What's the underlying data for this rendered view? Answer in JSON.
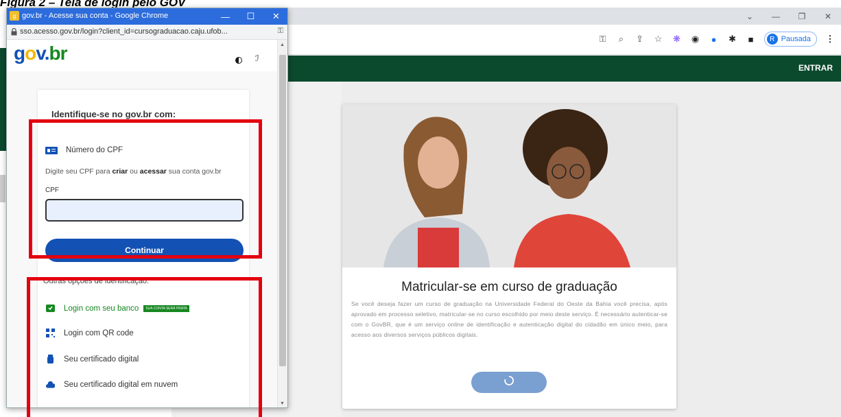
{
  "doc_caption": "Figura 2 – Tela de login pelo GOV",
  "popup": {
    "title": "gov.br - Acesse sua conta - Google Chrome",
    "url": "sso.acesso.gov.br/login?client_id=cursograduacao.caju.ufob...",
    "logo": {
      "g": "g",
      "o": "o",
      "v": "v",
      "dot": ".",
      "br": "br"
    },
    "login": {
      "title": "Identifique-se no gov.br com:",
      "cpf_option_label": "Número do CPF",
      "cpf_desc_pre": "Digite seu CPF para ",
      "cpf_desc_criar": "criar",
      "cpf_desc_mid": " ou ",
      "cpf_desc_acessar": "acessar",
      "cpf_desc_post": " sua conta gov.br",
      "cpf_field_label": "CPF",
      "cpf_value": "",
      "continue_label": "Continuar",
      "other_options_label": "Outras opções de identificação:",
      "options": [
        {
          "label": "Login com seu banco",
          "icon": "bank-icon",
          "badge": "SUA CONTA SERÁ PRATA"
        },
        {
          "label": "Login com QR code",
          "icon": "qr-code-icon"
        },
        {
          "label": "Seu certificado digital",
          "icon": "usb-token-icon"
        },
        {
          "label": "Seu certificado digital em nuvem",
          "icon": "cloud-icon"
        }
      ]
    }
  },
  "background": {
    "profile_initial": "R",
    "profile_status": "Pausada",
    "nav_entrar": "ENTRAR",
    "card_title": "Matricular-se em curso de graduação",
    "card_text": "Se você deseja fazer um curso de graduação na Universidade Federal do Oeste da Bahia você precisa, após aprovado em processo seletivo, matricular-se no curso escolhido por meio deste serviço. É necessário autenticar-se com o GovBR, que é um serviço online de identificação e autenticação digital do cidadão em único meio, para acesso aos diversos serviços públicos digitais.",
    "card_button_icon": "loading-spinner-icon"
  },
  "colors": {
    "gov_blue": "#1351b4",
    "gov_green": "#168821",
    "dark_green_nav": "#0c4a2e",
    "highlight_red": "#e3000f",
    "chrome_title_blue": "#2c6cdc"
  }
}
